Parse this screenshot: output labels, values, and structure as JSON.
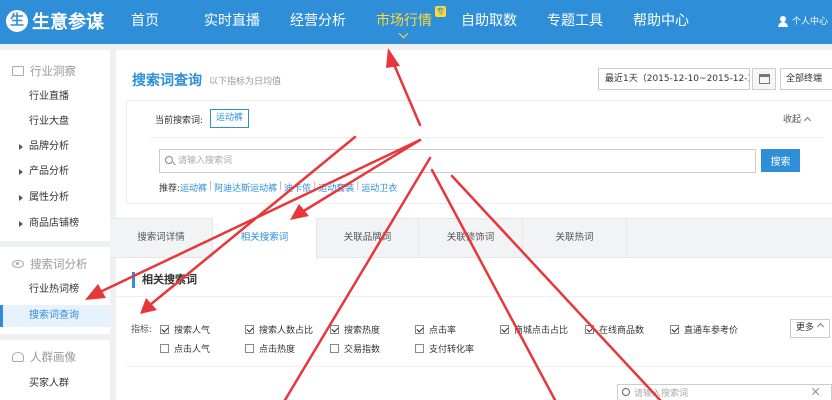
{
  "app": {
    "logo_text": "生意参谋",
    "logo_mark": "生"
  },
  "nav": {
    "items": [
      {
        "label": "首页"
      },
      {
        "label": "实时直播"
      },
      {
        "label": "经营分析"
      },
      {
        "label": "市场行情",
        "active": true,
        "badge": "专"
      },
      {
        "label": "自助取数"
      },
      {
        "label": "专题工具"
      },
      {
        "label": "帮助中心"
      }
    ],
    "user_label": "个人中心"
  },
  "sidebar": {
    "groups": [
      {
        "label": "行业洞察",
        "icon": "monitor-icon"
      },
      {
        "label": "搜索词分析",
        "icon": "eye-icon"
      },
      {
        "label": "人群画像",
        "icon": "people-icon"
      }
    ],
    "items": [
      {
        "label": "行业直播"
      },
      {
        "label": "行业大盘"
      },
      {
        "label": "品牌分析"
      },
      {
        "label": "产品分析"
      },
      {
        "label": "属性分析"
      },
      {
        "label": "商品店铺榜"
      },
      {
        "label": "行业热词榜"
      },
      {
        "label": "搜索词查询",
        "active": true
      },
      {
        "label": "买家人群"
      }
    ]
  },
  "header": {
    "title": "搜索词查询",
    "subtitle": "以下指标为日均值",
    "date_range": "最近1天（2015-12-10~2015-12-10）",
    "terminal": "全部终端"
  },
  "search": {
    "current_label": "当前搜索词:",
    "current_keyword": "运动裤",
    "collapse_label": "收起",
    "placeholder": "请输入搜索词",
    "button_label": "搜索",
    "recommend_label": "推荐:",
    "recommend": [
      "运动裤",
      "阿迪达斯运动裤",
      "迪卡侬",
      "运动套装",
      "运动卫衣"
    ]
  },
  "tabs": [
    {
      "label": "搜索词详情"
    },
    {
      "label": "相关搜索词",
      "active": true
    },
    {
      "label": "关联品牌词"
    },
    {
      "label": "关联修饰词"
    },
    {
      "label": "关联热词"
    }
  ],
  "section": {
    "title": "相关搜索词"
  },
  "indicators": {
    "label": "指标:",
    "row1": [
      {
        "label": "搜索人气",
        "checked": true
      },
      {
        "label": "搜索人数占比",
        "checked": true
      },
      {
        "label": "搜索热度",
        "checked": true
      },
      {
        "label": "点击率",
        "checked": true
      },
      {
        "label": "商城点击占比",
        "checked": true
      },
      {
        "label": "在线商品数",
        "checked": true
      },
      {
        "label": "直通车参考价",
        "checked": true
      }
    ],
    "row2": [
      {
        "label": "点击人气",
        "checked": false
      },
      {
        "label": "点击热度",
        "checked": false
      },
      {
        "label": "交易指数",
        "checked": false
      },
      {
        "label": "支付转化率",
        "checked": false
      }
    ],
    "more_label": "更多"
  },
  "filter": {
    "placeholder": "请输入搜索词"
  },
  "colors": {
    "brand": "#2e8fd8",
    "nav_active": "#ffd83a",
    "annotation": "#e8373a"
  }
}
